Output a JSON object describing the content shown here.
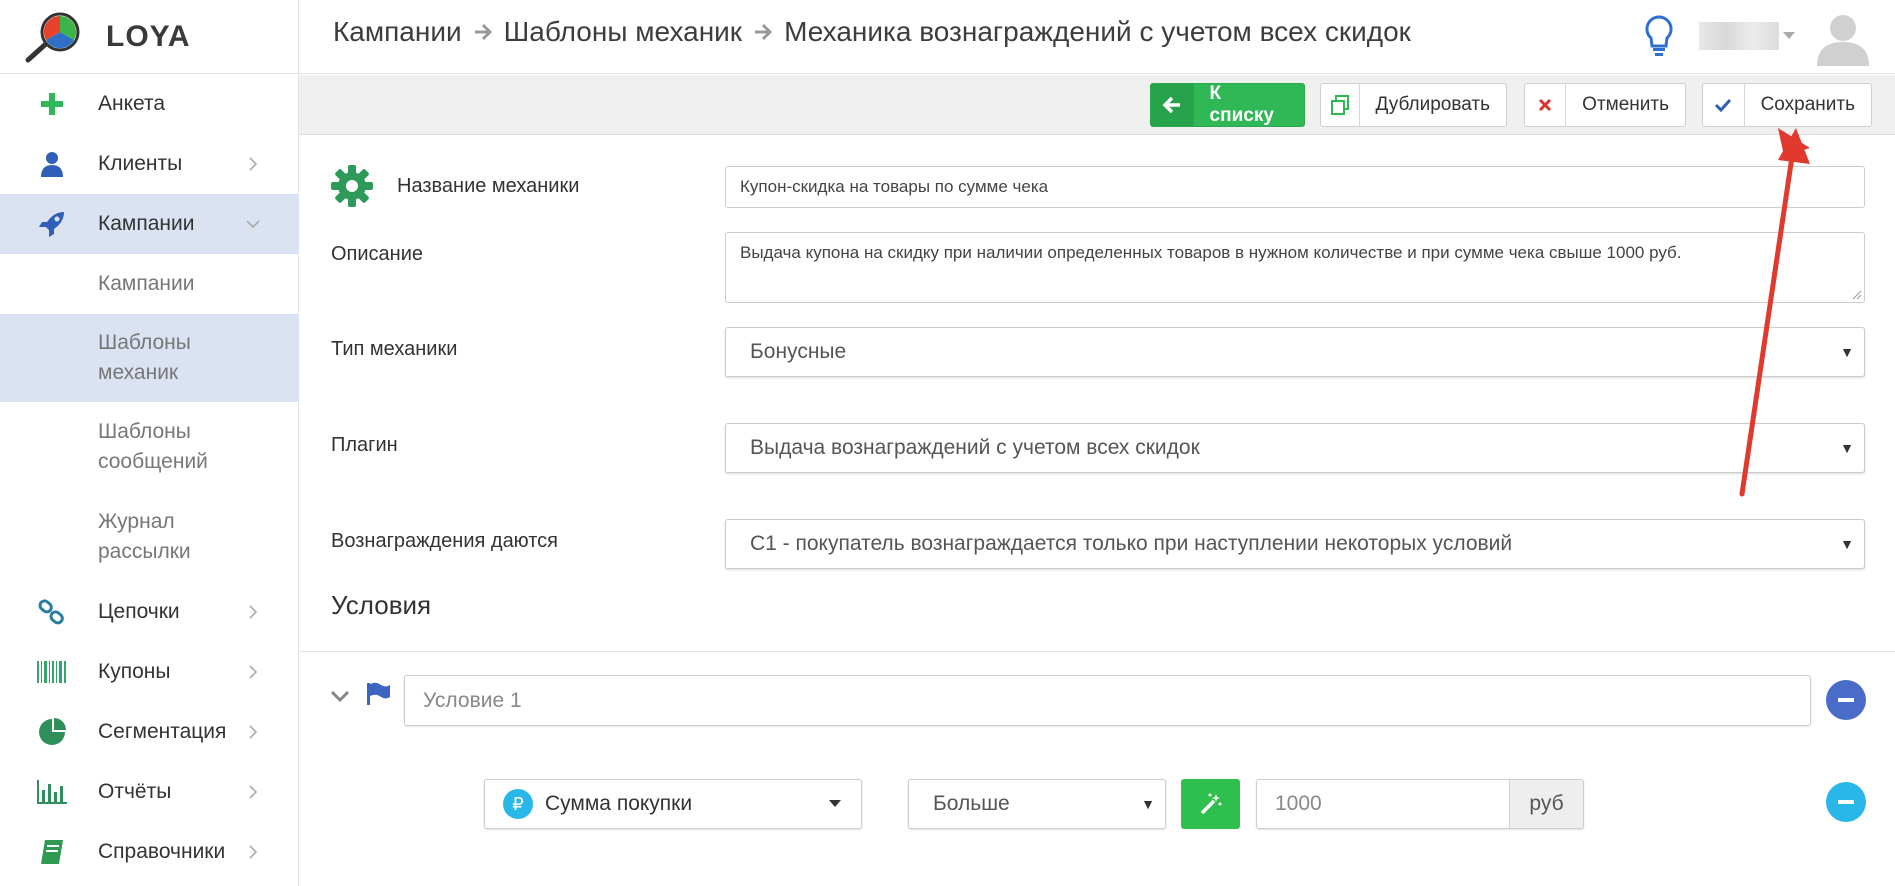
{
  "app": {
    "name": "LOYA"
  },
  "sidebar": {
    "items": [
      {
        "label": "Анкета",
        "icon": "plus-icon"
      },
      {
        "label": "Клиенты",
        "icon": "user-icon"
      },
      {
        "label": "Кампании",
        "icon": "rocket-icon"
      },
      {
        "label": "Цепочки",
        "icon": "chain-icon"
      },
      {
        "label": "Купоны",
        "icon": "barcode-icon"
      },
      {
        "label": "Сегментация",
        "icon": "pie-icon"
      },
      {
        "label": "Отчёты",
        "icon": "bar-chart-icon"
      },
      {
        "label": "Справочники",
        "icon": "book-icon"
      }
    ],
    "subitems": [
      {
        "line1": "Кампании",
        "line2": ""
      },
      {
        "line1": "Шаблоны",
        "line2": "механик"
      },
      {
        "line1": "Шаблоны",
        "line2": "сообщений"
      },
      {
        "line1": "Журнал",
        "line2": "рассылки"
      }
    ]
  },
  "header": {
    "breadcrumb": [
      "Кампании",
      "Шаблоны механик",
      "Механика вознаграждений с учетом всех скидок"
    ]
  },
  "toolbar": {
    "to_list": "К списку",
    "duplicate": "Дублировать",
    "cancel": "Отменить",
    "save": "Сохранить"
  },
  "form": {
    "name_label": "Название механики",
    "name_value": "Купон-скидка на товары по сумме чека",
    "description_label": "Описание",
    "description_value": "Выдача купона на скидку при наличии определенных товаров в нужном количестве и при сумме чека свыше 1000 руб.",
    "type_label": "Тип механики",
    "type_value": "Бонусные",
    "plugin_label": "Плагин",
    "plugin_value": "Выдача вознаграждений с учетом всех скидок",
    "rewards_label": "Вознаграждения даются",
    "rewards_value": "C1 - покупатель вознаграждается только при наступлении некоторых условий"
  },
  "conditions": {
    "title": "Условия",
    "condition_name": "Условие 1",
    "rule": {
      "field": "Сумма покупки",
      "currency_symbol": "₽",
      "operator": "Больше",
      "value": "1000",
      "unit": "руб"
    }
  },
  "colors": {
    "green": "#2fb855",
    "active_bg": "#dbe2f2",
    "annotation_red": "#e03a2f",
    "blue_round": "#4a6cc9",
    "cyan_round": "#29b6e8"
  }
}
